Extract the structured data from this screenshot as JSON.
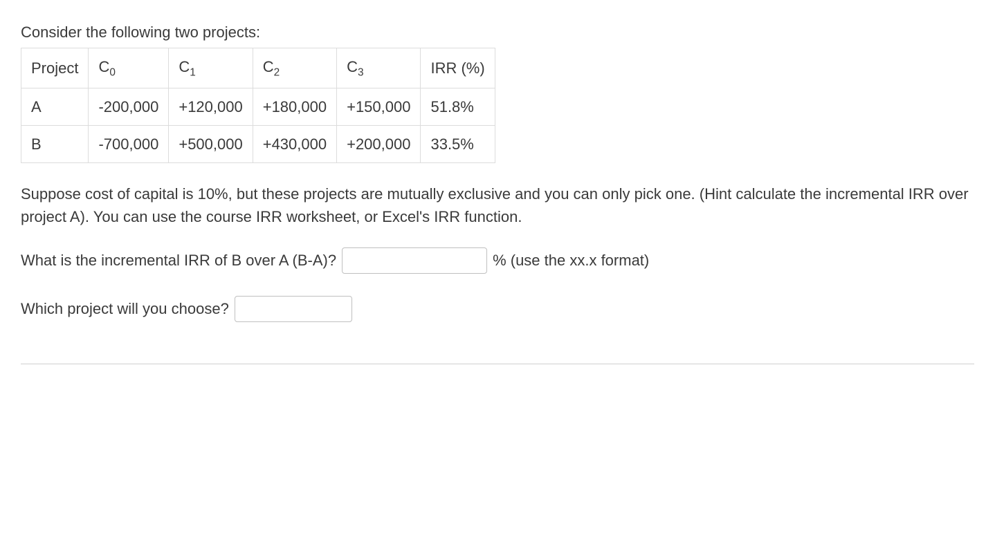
{
  "intro": "Consider the following two projects:",
  "table": {
    "headers": {
      "project": "Project",
      "c0_base": "C",
      "c0_sub": "0",
      "c1_base": "C",
      "c1_sub": "1",
      "c2_base": "C",
      "c2_sub": "2",
      "c3_base": "C",
      "c3_sub": "3",
      "irr": "IRR (%)"
    },
    "rows": [
      {
        "name": "A",
        "c0": "-200,000",
        "c1": "+120,000",
        "c2": "+180,000",
        "c3": "+150,000",
        "irr": "51.8%"
      },
      {
        "name": "B",
        "c0": "-700,000",
        "c1": "+500,000",
        "c2": "+430,000",
        "c3": "+200,000",
        "irr": "33.5%"
      }
    ]
  },
  "paragraph": "Suppose cost of capital is 10%, but these projects are mutually exclusive and you can only pick one. (Hint calculate the incremental IRR over project A). You can use the course IRR worksheet, or Excel's IRR function.",
  "q1": {
    "prompt": "What is the incremental IRR of B over A (B-A)?",
    "suffix": "% (use the xx.x format)"
  },
  "q2": {
    "prompt": "Which project will you choose?"
  },
  "chart_data": {
    "type": "table",
    "columns": [
      "Project",
      "C0",
      "C1",
      "C2",
      "C3",
      "IRR (%)"
    ],
    "rows": [
      [
        "A",
        -200000,
        120000,
        180000,
        150000,
        51.8
      ],
      [
        "B",
        -700000,
        500000,
        430000,
        200000,
        33.5
      ]
    ]
  }
}
